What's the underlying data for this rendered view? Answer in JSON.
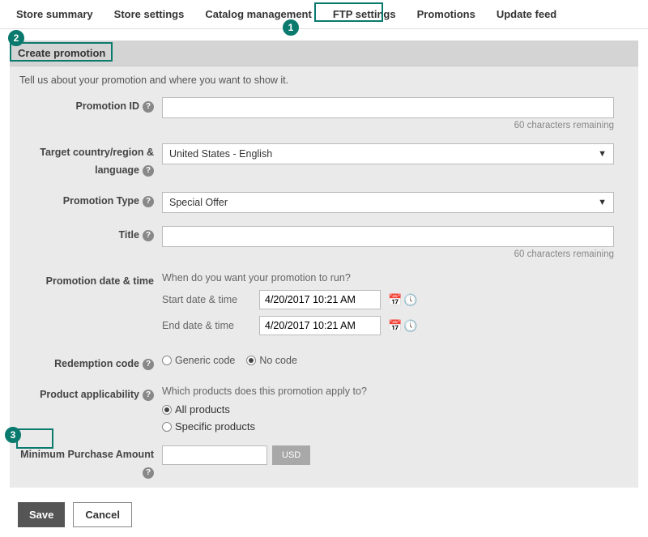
{
  "tabs": {
    "store_summary": "Store summary",
    "store_settings": "Store settings",
    "catalog_management": "Catalog management",
    "ftp_settings": "FTP settings",
    "promotions": "Promotions",
    "update_feed": "Update feed"
  },
  "callouts": {
    "c1": "1",
    "c2": "2",
    "c3": "3"
  },
  "panel": {
    "title": "Create promotion",
    "tagline": "Tell us about your promotion and where you want to show it."
  },
  "labels": {
    "promotion_id": "Promotion ID",
    "target": "Target country/region & language",
    "promo_type": "Promotion Type",
    "title": "Title",
    "promo_date": "Promotion date & time",
    "redemption": "Redemption code",
    "applicability": "Product applicability",
    "min_purchase": "Minimum Purchase Amount"
  },
  "form": {
    "promotion_id_value": "",
    "promotion_id_remaining": "60 characters remaining",
    "target_value": "United States - English",
    "promo_type_value": "Special Offer",
    "title_value": "",
    "title_remaining": "60 characters remaining",
    "date_desc": "When do you want your promotion to run?",
    "start_label": "Start date & time",
    "end_label": "End date & time",
    "start_value": "4/20/2017 10:21 AM",
    "end_value": "4/20/2017 10:21 AM",
    "redemption_generic": "Generic code",
    "redemption_none": "No code",
    "applicability_desc": "Which products does this promotion apply to?",
    "applicability_all": "All products",
    "applicability_specific": "Specific products",
    "currency": "USD",
    "min_purchase_value": ""
  },
  "actions": {
    "save": "Save",
    "cancel": "Cancel"
  }
}
